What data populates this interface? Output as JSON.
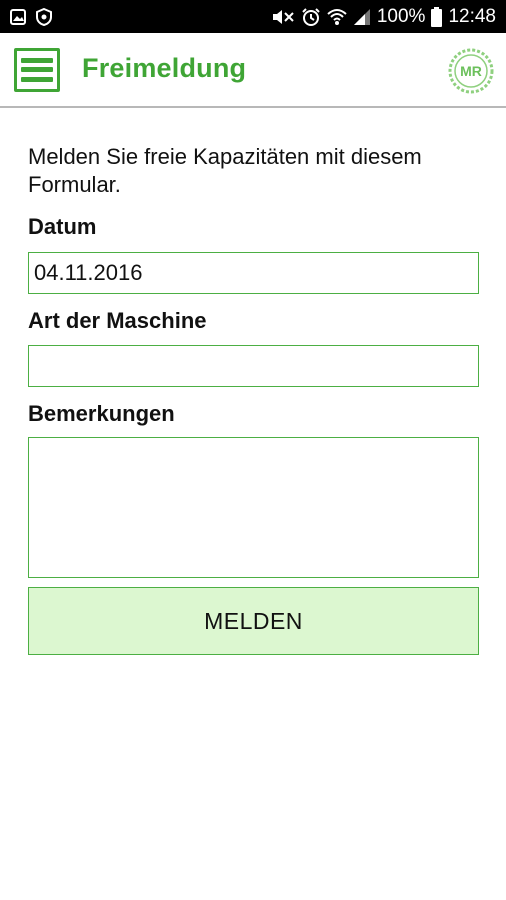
{
  "status_bar": {
    "battery_percent": "100%",
    "time": "12:48",
    "icons": [
      "gallery-icon",
      "shield-icon",
      "mute-icon",
      "alarm-icon",
      "wifi-icon",
      "signal-icon",
      "battery-icon"
    ]
  },
  "app_bar": {
    "title": "Freimeldung",
    "logo_text": "MR",
    "accent_color": "#3fa535"
  },
  "form": {
    "intro": "Melden Sie freie Kapazitäten mit diesem Formular.",
    "datum_label": "Datum",
    "datum_value": "04.11.2016",
    "maschine_label": "Art der Maschine",
    "maschine_value": "",
    "bemerkungen_label": "Bemerkungen",
    "bemerkungen_value": "",
    "submit_label": "MELDEN",
    "field_border_color": "#4caf43",
    "button_bg_color": "#dcf7d0"
  }
}
